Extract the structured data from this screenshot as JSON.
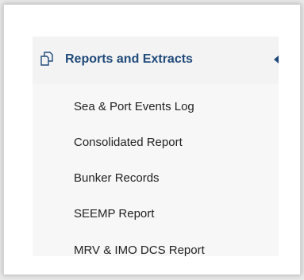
{
  "menu": {
    "header": {
      "title": "Reports and Extracts",
      "icon": "documents-icon",
      "indicator_icon": "collapse-left-icon"
    },
    "items": [
      {
        "label": "Sea & Port Events Log"
      },
      {
        "label": "Consolidated Report"
      },
      {
        "label": "Bunker Records"
      },
      {
        "label": "SEEMP Report"
      },
      {
        "label": "MRV & IMO DCS Report"
      }
    ]
  },
  "colors": {
    "accent": "#1f4a7a",
    "text": "#222222",
    "header_bg": "#f3f3f3",
    "menu_bg": "#f7f7f7"
  }
}
